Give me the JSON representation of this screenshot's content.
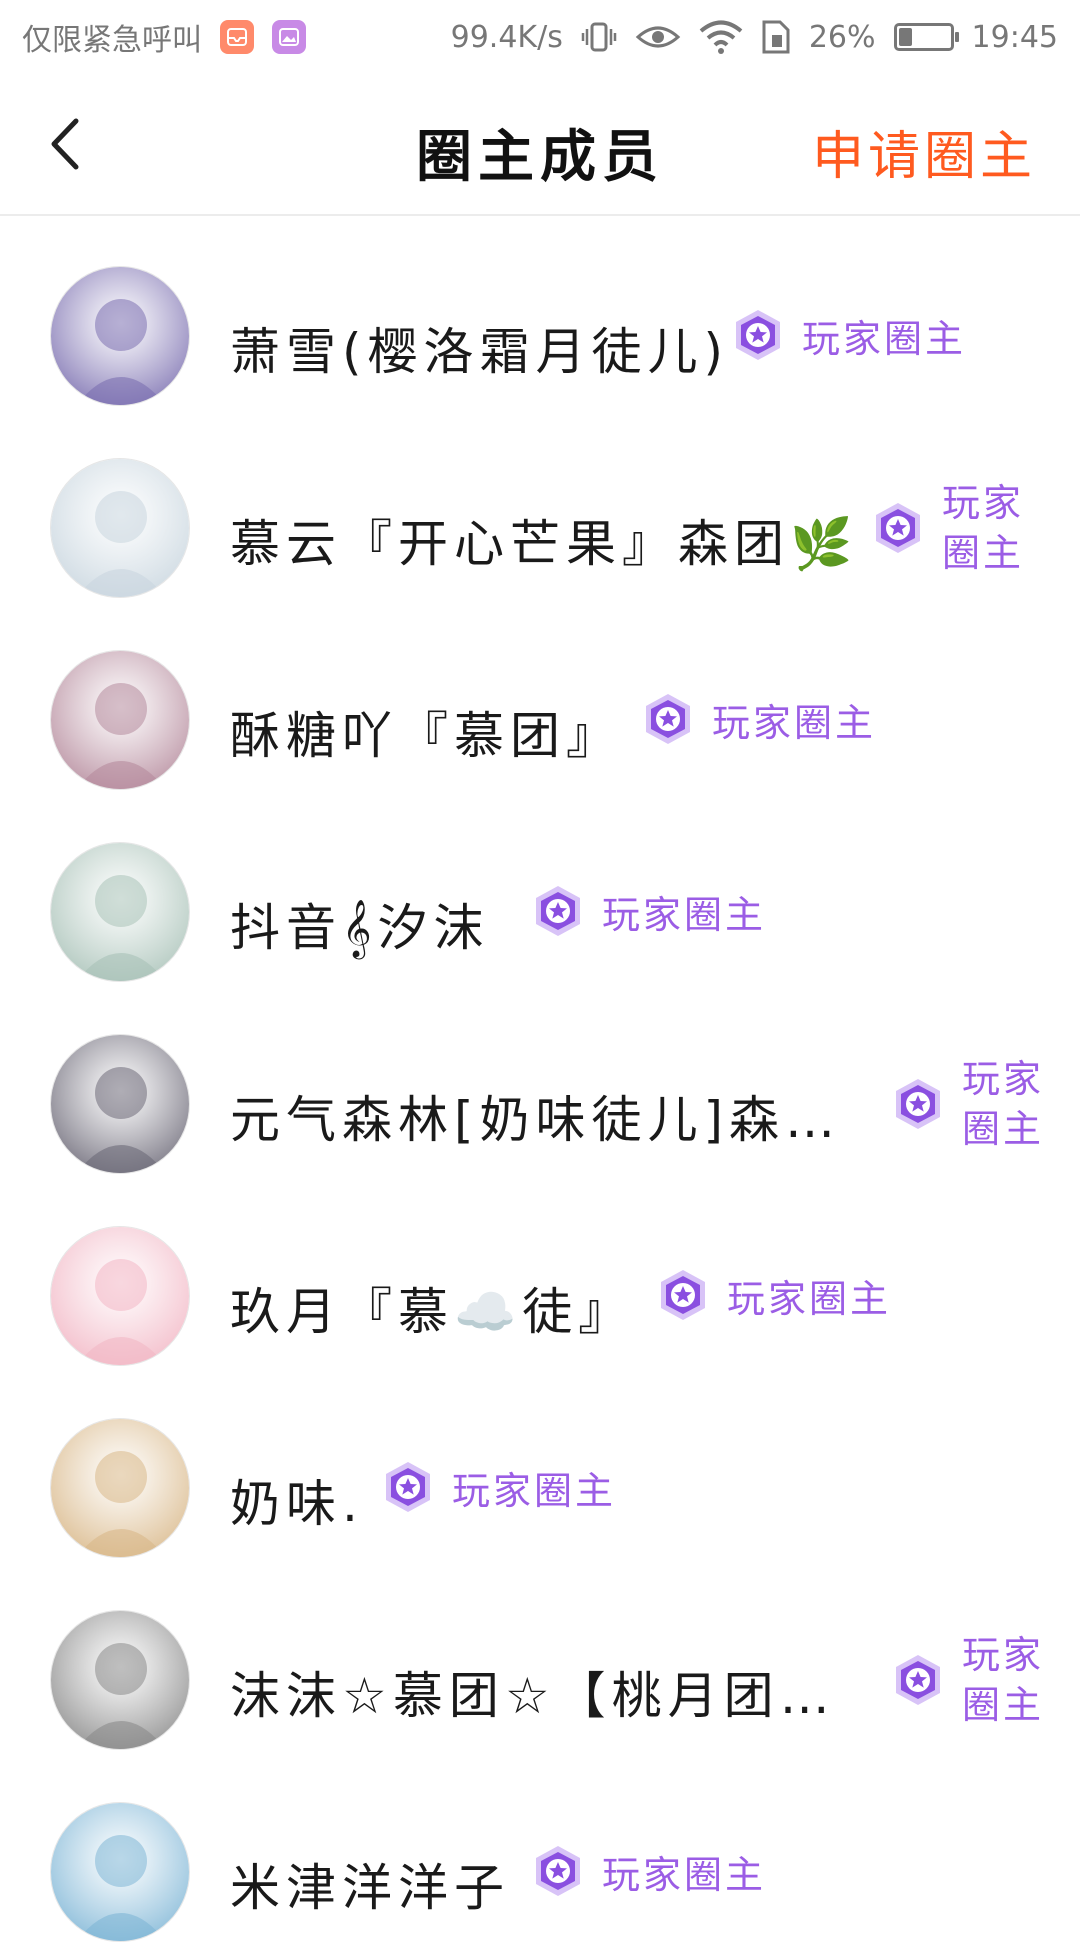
{
  "status_bar": {
    "left_text": "仅限紧急呼叫",
    "net_speed": "99.4K/s",
    "battery_pct": "26%",
    "battery_level": 0.26,
    "time": "19:45"
  },
  "header": {
    "title": "圈主成员",
    "action_label": "申请圈主"
  },
  "badge_label": "玩家圈主",
  "members": [
    {
      "name": "萧雪(樱洛霜月徒儿)",
      "avatar_color": "#7b6fb0",
      "badge_label": "玩家圈主"
    },
    {
      "name": "慕云『开心芒果』森团🌿",
      "avatar_color": "#c9d6df",
      "badge_label": "玩家圈主"
    },
    {
      "name": "酥糖吖『慕团』",
      "avatar_color": "#b58a9c",
      "badge_label": "玩家圈主"
    },
    {
      "name": "抖音𝄞汐沫",
      "avatar_color": "#a9c2b8",
      "badge_label": "玩家圈主"
    },
    {
      "name": "元气森林[奶味徒儿]森…",
      "avatar_color": "#6d6a78",
      "badge_label": "玩家圈主"
    },
    {
      "name": "玖月『慕☁️徒』",
      "avatar_color": "#f2b7c5",
      "badge_label": "玩家圈主"
    },
    {
      "name": "奶味.",
      "avatar_color": "#d9b889",
      "badge_label": "玩家圈主"
    },
    {
      "name": "沫沫☆慕团☆【桃月团…",
      "avatar_color": "#8a8a8a",
      "badge_label": "玩家圈主"
    },
    {
      "name": "米津洋洋子",
      "avatar_color": "#7fb6d6",
      "badge_label": "玩家圈主"
    }
  ]
}
